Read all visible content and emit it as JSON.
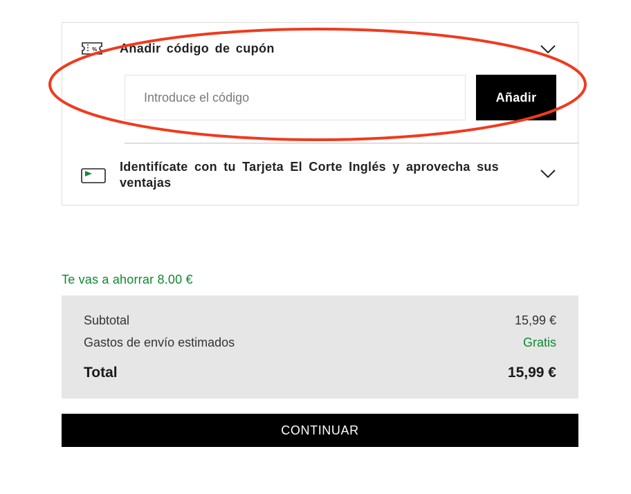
{
  "coupon": {
    "title": "Añadir código de cupón",
    "input_placeholder": "Introduce el código",
    "input_value": "",
    "add_label": "Añadir",
    "icon": "coupon-ticket-icon"
  },
  "loyalty_card": {
    "text": "Identifícate con tu Tarjeta El Corte Inglés y aprovecha sus ventajas",
    "icon": "eci-card-icon"
  },
  "savings": {
    "text": "Te vas a ahorrar 8.00 €"
  },
  "summary": {
    "subtotal_label": "Subtotal",
    "subtotal_value": "15,99 €",
    "shipping_label": "Gastos de envío estimados",
    "shipping_value": "Gratis",
    "total_label": "Total",
    "total_value": "15,99 €"
  },
  "continue_label": "CONTINUAR",
  "colors": {
    "accent_green": "#0c8a2f",
    "annotation_red": "#f03a1e",
    "button_black": "#000000",
    "summary_bg": "#e6e6e6"
  }
}
